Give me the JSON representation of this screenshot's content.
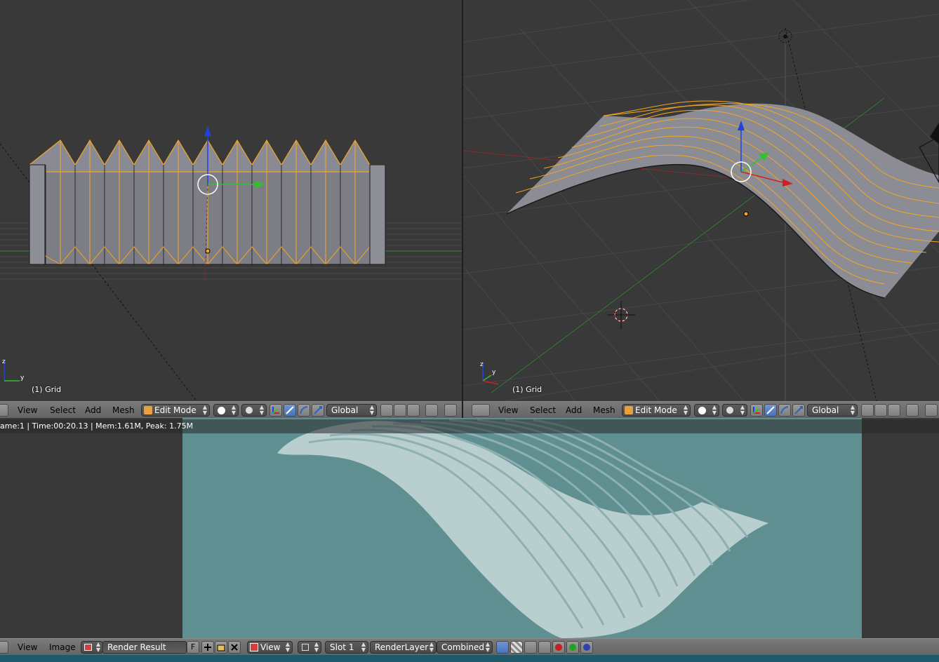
{
  "left_view": {
    "object_label": "(1) Grid",
    "menu": [
      "View",
      "Select",
      "Add",
      "Mesh"
    ],
    "mode": "Edit Mode",
    "orientation": "Global"
  },
  "right_view": {
    "object_label": "(1) Grid",
    "menu": [
      "View",
      "Select",
      "Add",
      "Mesh"
    ],
    "mode": "Edit Mode",
    "orientation": "Global"
  },
  "image_editor": {
    "stats": "ame:1 | Time:00:20.13 | Mem:1.61M, Peak: 1.75M",
    "menu": [
      "View",
      "Image"
    ],
    "image_name": "Render Result",
    "fake_user": "F",
    "view": "View",
    "slot": "Slot 1",
    "layer": "RenderLayer",
    "pass": "Combined",
    "render_bg": "#5f8f90",
    "surface_color": "#b9cfcf"
  },
  "colors": {
    "viewport_bg": "#393939",
    "selection_orange": "#f5a623",
    "axis_x": "#d02020",
    "axis_y": "#30c030",
    "axis_z": "#2040e0"
  }
}
